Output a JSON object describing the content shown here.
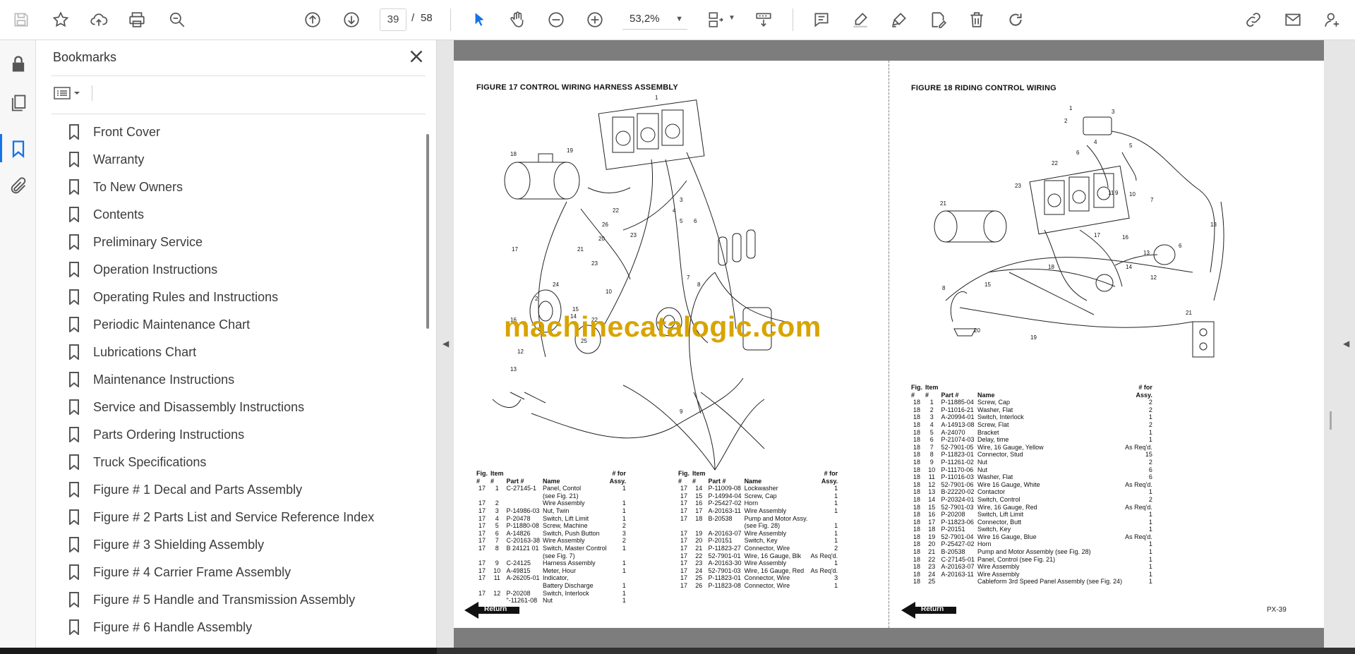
{
  "toolbar": {
    "current_page": "39",
    "page_separator": "/",
    "total_pages": "58",
    "zoom": "53,2%"
  },
  "bookmarks": {
    "title": "Bookmarks",
    "items": [
      {
        "label": "Front Cover"
      },
      {
        "label": "Warranty"
      },
      {
        "label": "To New Owners"
      },
      {
        "label": "Contents"
      },
      {
        "label": "Preliminary Service"
      },
      {
        "label": "Operation Instructions"
      },
      {
        "label": "Operating Rules and Instructions"
      },
      {
        "label": "Periodic Maintenance Chart"
      },
      {
        "label": "Lubrications Chart"
      },
      {
        "label": "Maintenance Instructions"
      },
      {
        "label": "Service and Disassembly Instructions"
      },
      {
        "label": "Parts Ordering Instructions"
      },
      {
        "label": "Truck Specifications"
      },
      {
        "label": "Figure # 1 Decal and Parts Assembly"
      },
      {
        "label": "Figure # 2 Parts List and Service Reference Index"
      },
      {
        "label": "Figure # 3 Shielding Assembly"
      },
      {
        "label": "Figure # 4 Carrier Frame Assembly"
      },
      {
        "label": "Figure # 5 Handle and Transmission Assembly"
      },
      {
        "label": "Figure # 6 Handle Assembly"
      }
    ]
  },
  "document": {
    "watermark": "machinecatalogic.com",
    "left_page": {
      "figure_title": "FIGURE 17  CONTROL WIRING HARNESS ASSEMBLY",
      "headers": {
        "fig": "Fig.\n#",
        "item": "Item\n#",
        "part": "Part #",
        "name": "Name",
        "qty": "# for\nAssy."
      },
      "table_a": [
        [
          "17",
          "1",
          "C-27145-1",
          "Panel, Contol",
          "1"
        ],
        [
          "",
          "",
          "",
          "(see Fig. 21)",
          ""
        ],
        [
          "17",
          "2",
          "",
          "Wire Assembly",
          "1"
        ],
        [
          "17",
          "3",
          "P-14986-03",
          "Nut, Twin",
          "1"
        ],
        [
          "17",
          "4",
          "P-20478",
          "Switch, Lift Limit",
          "1"
        ],
        [
          "17",
          "5",
          "P-11880-08",
          "Screw, Machine",
          "2"
        ],
        [
          "17",
          "6",
          "A-14826",
          "Switch, Push Button",
          "3"
        ],
        [
          "17",
          "7",
          "C-20163-38",
          "Wire Assembly",
          "2"
        ],
        [
          "17",
          "8",
          "B 24121 01",
          "Switch, Master Control",
          "1"
        ],
        [
          "",
          "",
          "",
          "(see Fig. 7)",
          ""
        ],
        [
          "17",
          "9",
          "C-24125",
          "Harness Assembly",
          "1"
        ],
        [
          "17",
          "10",
          "A-49815",
          "Meter, Hour",
          "1"
        ],
        [
          "17",
          "11",
          "A-26205-01",
          "Indicator,",
          ""
        ],
        [
          "",
          "",
          "",
          "Battery Discharge",
          "1"
        ],
        [
          "17",
          "12",
          "P-20208",
          "Switch, Interlock",
          "1"
        ],
        [
          "",
          "",
          "\"-11261-08",
          "Nut",
          "1"
        ]
      ],
      "table_b": [
        [
          "17",
          "14",
          "P-11009-08",
          "Lockwasher",
          "1"
        ],
        [
          "17",
          "15",
          "P-14994-04",
          "Screw, Cap",
          "1"
        ],
        [
          "17",
          "16",
          "P-25427-02",
          "Horn",
          "1"
        ],
        [
          "17",
          "17",
          "A-20163-11",
          "Wire Assembly",
          "1"
        ],
        [
          "17",
          "18",
          "B-20538",
          "Pump and Motor Assy.",
          ""
        ],
        [
          "",
          "",
          "",
          "(see Fig. 28)",
          "1"
        ],
        [
          "17",
          "19",
          "A-20163-07",
          "Wire Assembly",
          "1"
        ],
        [
          "17",
          "20",
          "P-20151",
          "Switch, Key",
          "1"
        ],
        [
          "17",
          "21",
          "P-11823-27",
          "Connector, Wire",
          "2"
        ],
        [
          "17",
          "22",
          "52-7901-01",
          "Wire, 16 Gauge, Blk",
          "As Req'd."
        ],
        [
          "17",
          "23",
          "A-20163-30",
          "Wire Assembly",
          "1"
        ],
        [
          "17",
          "24",
          "52-7901-03",
          "Wire, 16 Gauge, Red",
          "As Req'd."
        ],
        [
          "17",
          "25",
          "P-11823-01",
          "Connector, Wire",
          "3"
        ],
        [
          "17",
          "26",
          "P-11823-08",
          "Connector, Wire",
          "1"
        ]
      ],
      "return_label": "Return"
    },
    "right_page": {
      "figure_title": "FIGURE 18  RIDING CONTROL WIRING",
      "headers": {
        "fig": "Fig.\n#",
        "item": "Item\n#",
        "part": "Part #",
        "name": "Name",
        "qty": "# for\nAssy."
      },
      "table": [
        [
          "18",
          "1",
          "P-11885-04",
          "Screw, Cap",
          "2"
        ],
        [
          "18",
          "2",
          "P-11016-21",
          "Washer, Flat",
          "2"
        ],
        [
          "18",
          "3",
          "A-20994-01",
          "Switch, Interlock",
          "1"
        ],
        [
          "18",
          "4",
          "A-14913-08",
          "Screw, Flat",
          "2"
        ],
        [
          "18",
          "5",
          "A-24070",
          "Bracket",
          "1"
        ],
        [
          "18",
          "6",
          "P-21074-03",
          "Delay, time",
          "1"
        ],
        [
          "18",
          "7",
          "52-7901-05",
          "Wire, 16 Gauge, Yellow",
          "As Req'd."
        ],
        [
          "18",
          "8",
          "P-11823-01",
          "Connector, Stud",
          "15"
        ],
        [
          "18",
          "9",
          "P-11261-02",
          "Nut",
          "2"
        ],
        [
          "18",
          "10",
          "P-11170-06",
          "Nut",
          "6"
        ],
        [
          "18",
          "11",
          "P-11016-03",
          "Washer, Flat",
          "6"
        ],
        [
          "18",
          "12",
          "52-7901-06",
          "Wire 16 Gauge, White",
          "As Req'd."
        ],
        [
          "18",
          "13",
          "B-22220-02",
          "Contactor",
          "1"
        ],
        [
          "18",
          "14",
          "P-20324-01",
          "Switch, Control",
          "2"
        ],
        [
          "18",
          "15",
          "52-7901-03",
          "Wire, 16 Gauge, Red",
          "As Req'd."
        ],
        [
          "18",
          "16",
          "P-20208",
          "Switch, Lift Limit",
          "1"
        ],
        [
          "18",
          "17",
          "P-11823-06",
          "Connector, Butt",
          "1"
        ],
        [
          "18",
          "18",
          "P-20151",
          "Switch, Key",
          "1"
        ],
        [
          "18",
          "19",
          "52-7901-04",
          "Wire 16 Gauge, Blue",
          "As Req'd."
        ],
        [
          "18",
          "20",
          "P-25427-02",
          "Horn",
          "1"
        ],
        [
          "18",
          "21",
          "B-20538",
          "Pump and Motor Assembly (see Fig. 28)",
          "1"
        ],
        [
          "18",
          "22",
          "C-27145-01",
          "Panel, Control (see Fig. 21)",
          "1"
        ],
        [
          "18",
          "23",
          "A-20163-07",
          "Wire Assembly",
          "1"
        ],
        [
          "18",
          "24",
          "A-20163-11",
          "Wire Assembly",
          "1"
        ],
        [
          "18",
          "25",
          "",
          "Cableform 3rd Speed Panel Assembly (see Fig. 24)",
          "1"
        ]
      ],
      "return_label": "Return",
      "page_number": "PX-39"
    }
  }
}
